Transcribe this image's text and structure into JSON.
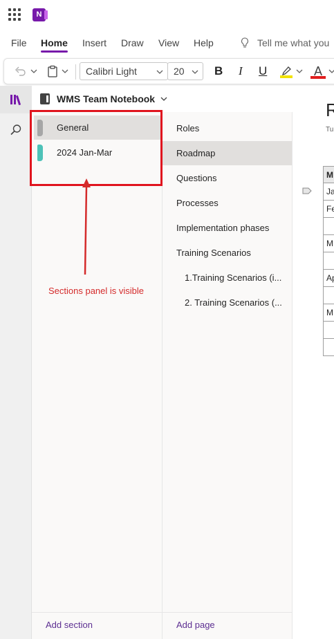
{
  "app": {
    "logo_letter": "N",
    "accent": "#7719aa"
  },
  "ribbon": {
    "tabs": [
      {
        "label": "File",
        "active": false
      },
      {
        "label": "Home",
        "active": true
      },
      {
        "label": "Insert",
        "active": false
      },
      {
        "label": "Draw",
        "active": false
      },
      {
        "label": "View",
        "active": false
      },
      {
        "label": "Help",
        "active": false
      }
    ],
    "tell_me": "Tell me what you"
  },
  "toolbar": {
    "font_name": "Calibri Light",
    "font_size": "20",
    "bold_label": "B",
    "italic_label": "I",
    "underline_label": "U",
    "font_color_label": "A",
    "highlight_color": "#f2e205",
    "font_color": "#e01e1e"
  },
  "notebook": {
    "title": "WMS Team Notebook"
  },
  "sections": {
    "items": [
      {
        "label": "General",
        "color": "#a6a6a6",
        "selected": true
      },
      {
        "label": "2024 Jan-Mar",
        "color": "#4ec2b8",
        "selected": false
      }
    ],
    "add_label": "Add section"
  },
  "pages": {
    "items": [
      {
        "label": "Roles",
        "indent": 0,
        "selected": false
      },
      {
        "label": "Roadmap",
        "indent": 0,
        "selected": true
      },
      {
        "label": "Questions",
        "indent": 0,
        "selected": false
      },
      {
        "label": "Processes",
        "indent": 0,
        "selected": false
      },
      {
        "label": "Implementation phases",
        "indent": 0,
        "selected": false
      },
      {
        "label": "Training Scenarios",
        "indent": 0,
        "selected": false
      },
      {
        "label": "1.Training Scenarios (i...",
        "indent": 1,
        "selected": false
      },
      {
        "label": "2. Training Scenarios (...",
        "indent": 1,
        "selected": false
      }
    ],
    "add_label": "Add page"
  },
  "canvas": {
    "title_peek": "R",
    "date_peek": "Tu",
    "table_rows": [
      "M",
      "Ja",
      "Fe",
      "",
      "M",
      "",
      "Ap",
      "",
      "M",
      "",
      ""
    ]
  },
  "annotation": {
    "text": "Sections panel is visible",
    "color": "#d42b2b"
  }
}
